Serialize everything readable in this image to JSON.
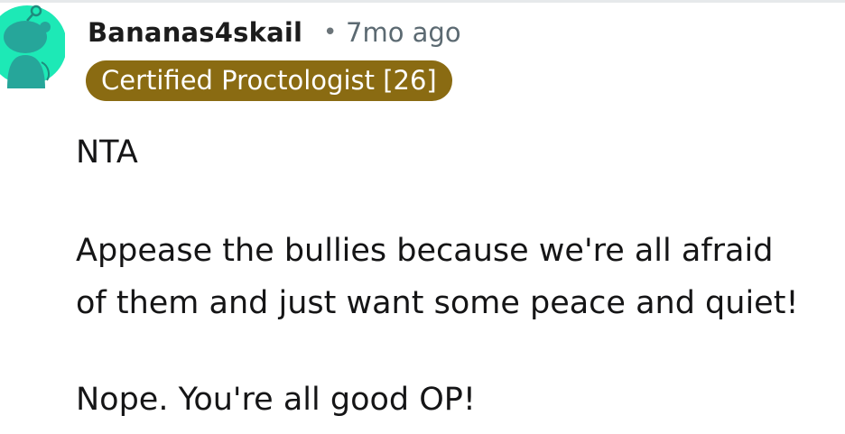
{
  "comment": {
    "author": "Bananas4skail",
    "separator": "•",
    "timestamp": "7mo ago",
    "flair": "Certified Proctologist [26]",
    "body_lines": [
      "NTA",
      "Appease the bullies because we're all afraid",
      "of them and just want some peace and quiet!",
      "Nope. You're all good OP!"
    ]
  },
  "avatar": {
    "icon": "snoo-avatar-icon",
    "background_color": "#1de9b6",
    "figure_color": "#26a69a"
  },
  "colors": {
    "flair_background": "#8a6b12",
    "flair_text": "#ffffff",
    "meta_text": "#5c6a72"
  }
}
